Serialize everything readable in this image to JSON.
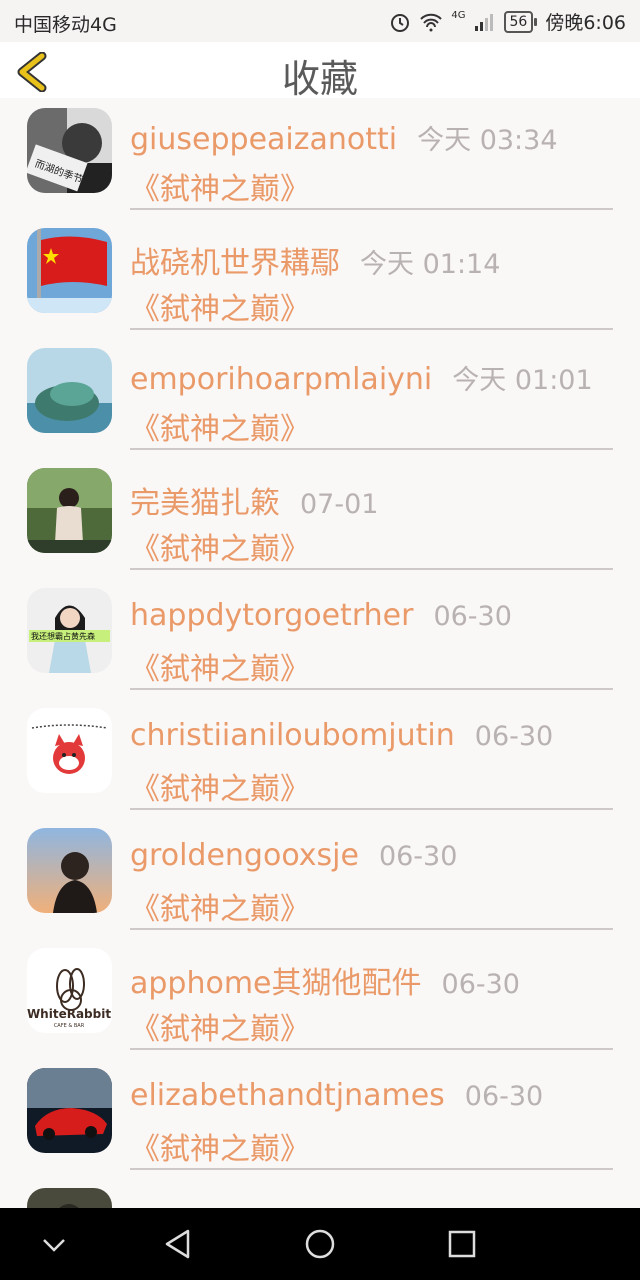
{
  "status_bar": {
    "carrier": "中国移动4G",
    "network_label": "4G",
    "battery": "56",
    "time": "傍晚6:06"
  },
  "header": {
    "title": "收藏"
  },
  "items": [
    {
      "name": "giuseppeaizanotti",
      "time": "今天 03:34",
      "book": "《弑神之巅》"
    },
    {
      "name": "战硗机世界耩鄢",
      "time": "今天 01:14",
      "book": "《弑神之巅》"
    },
    {
      "name": "emporihoarpmlaiyni",
      "time": "今天 01:01",
      "book": "《弑神之巅》"
    },
    {
      "name": "完美猫扎簌",
      "time": "07-01",
      "book": "《弑神之巅》"
    },
    {
      "name": "happdytorgoetrher",
      "time": "06-30",
      "book": "《弑神之巅》"
    },
    {
      "name": "christiianiloubomjutin",
      "time": "06-30",
      "book": "《弑神之巅》"
    },
    {
      "name": "groldengooxsje",
      "time": "06-30",
      "book": "《弑神之巅》"
    },
    {
      "name": "apphome其猢他配件",
      "time": "06-30",
      "book": "《弑神之巅》"
    },
    {
      "name": "elizabethandtjnames",
      "time": "06-30",
      "book": "《弑神之巅》"
    }
  ],
  "avatars": {
    "avatar_1_text": "而湖的季节",
    "avatar_5_text": "我还想霸占黄先森",
    "avatar_8_brand": "WhiteRabbit",
    "avatar_8_sub": "CAFE & BAR"
  },
  "colors": {
    "accent": "#ea9a68",
    "time": "#b9b2b2",
    "back_icon": "#e8c21a"
  }
}
